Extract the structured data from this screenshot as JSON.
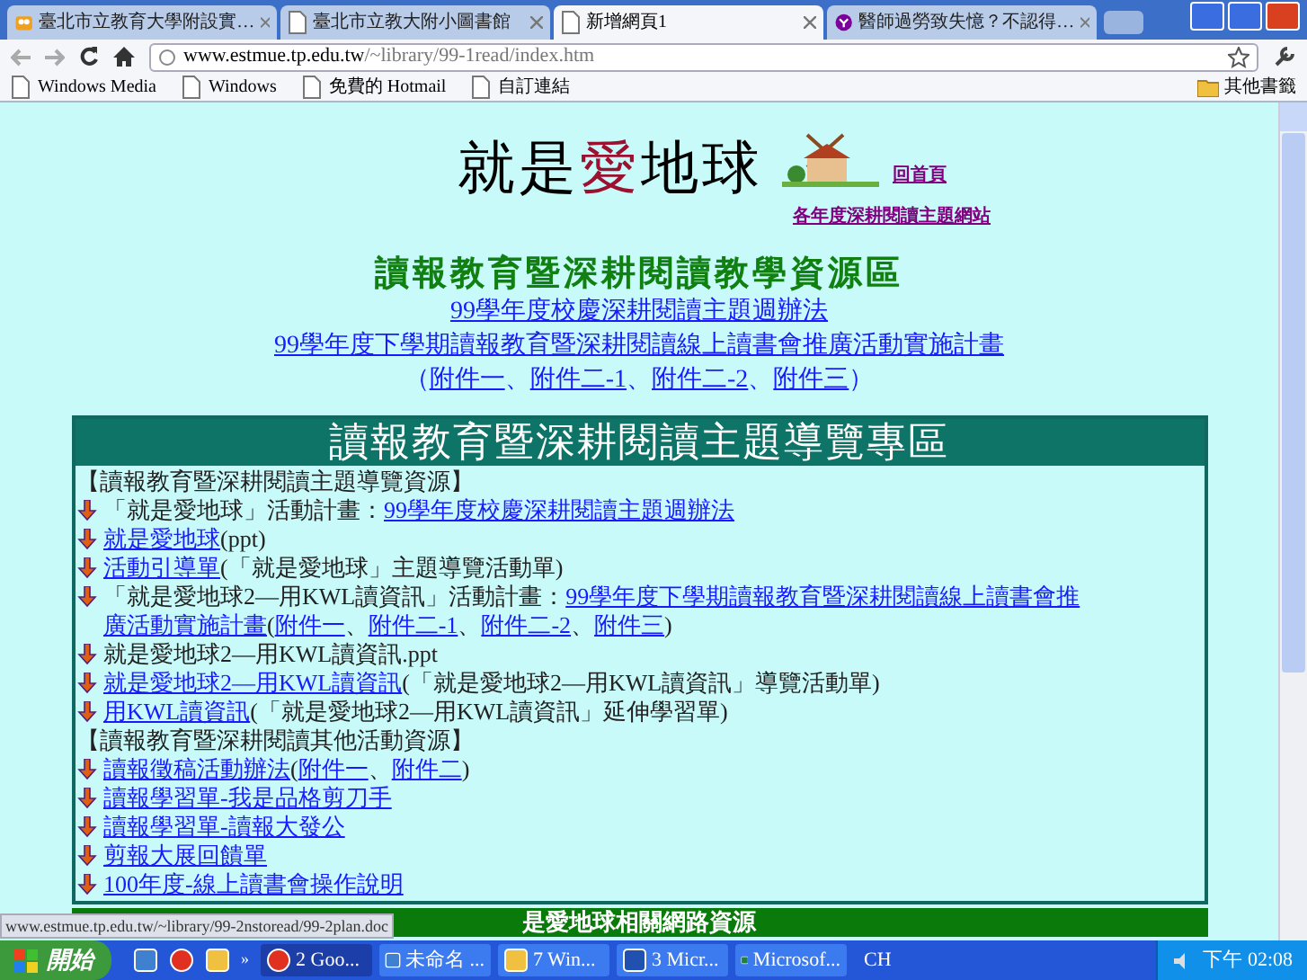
{
  "browser": {
    "tabs": [
      {
        "title": "臺北市立教育大學附設實…",
        "selected": false
      },
      {
        "title": "臺北市立教大附小圖書館",
        "selected": false
      },
      {
        "title": "新增網頁1",
        "selected": true
      },
      {
        "title": "醫師過勞致失憶？不認得…",
        "selected": false
      }
    ],
    "address": {
      "host": "www.estmue.tp.edu.tw",
      "path": "/~library/99-1read/index.htm"
    },
    "bookmarks": [
      "Windows Media",
      "Windows",
      "免費的 Hotmail",
      "自訂連結"
    ],
    "other_bookmarks": "其他書籤"
  },
  "page": {
    "title_parts": [
      {
        "text": "就是",
        "color": "#000000"
      },
      {
        "text": "愛",
        "color": "#9c1030"
      },
      {
        "text": "地球",
        "color": "#000000"
      }
    ],
    "home_link": "回首頁",
    "sites_link": "各年度深耕閱讀主題網站",
    "section_title": "讀報教育暨深耕閱讀教學資源區",
    "links": [
      "99學年度校慶深耕閱讀主題週辦法",
      "99學年度下學期讀報教育暨深耕閱讀線上讀書會推廣活動實施計畫"
    ],
    "attachments": {
      "open": "（",
      "close": "）",
      "separator": "、",
      "items": [
        "附件一",
        "附件二-1",
        "附件二-2",
        "附件三"
      ]
    },
    "panel": {
      "title": "讀報教育暨深耕閱讀主題導覽專區",
      "entries": [
        {
          "kind": "heading",
          "parts": [
            {
              "text": "【讀報教育暨深耕閱讀主題導覽資源】",
              "link": false
            }
          ]
        },
        {
          "kind": "item",
          "parts": [
            {
              "text": "「就是愛地球」活動計畫：",
              "link": false
            },
            {
              "text": "99學年度校慶深耕閱讀主題週辦法",
              "link": true
            }
          ]
        },
        {
          "kind": "item",
          "parts": [
            {
              "text": "就是愛地球",
              "link": true
            },
            {
              "text": "(ppt)",
              "link": false
            }
          ]
        },
        {
          "kind": "item",
          "parts": [
            {
              "text": "活動引導單",
              "link": true
            },
            {
              "text": "(「就是愛地球」主題導覽活動單)",
              "link": false
            }
          ]
        },
        {
          "kind": "item",
          "parts": [
            {
              "text": "「就是愛地球2—用KWL讀資訊」活動計畫：",
              "link": false
            },
            {
              "text": "99學年度下學期讀報教育暨深耕閱讀線上讀書會推",
              "link": true
            },
            {
              "text": "廣活動實施計畫",
              "link": true
            },
            {
              "text": "(",
              "link": false
            },
            {
              "text": "附件一",
              "link": true
            },
            {
              "text": "、",
              "link": false
            },
            {
              "text": "附件二-1",
              "link": true
            },
            {
              "text": "、",
              "link": false
            },
            {
              "text": "附件二-2",
              "link": true
            },
            {
              "text": "、",
              "link": false
            },
            {
              "text": "附件三",
              "link": true
            },
            {
              "text": ")",
              "link": false
            }
          ]
        },
        {
          "kind": "item",
          "parts": [
            {
              "text": "就是愛地球2—用KWL讀資訊.ppt",
              "link": false
            }
          ]
        },
        {
          "kind": "item",
          "parts": [
            {
              "text": "就是愛地球2—用KWL讀資訊",
              "link": true
            },
            {
              "text": "(「就是愛地球2—用KWL讀資訊」導覽活動單)",
              "link": false
            }
          ]
        },
        {
          "kind": "item",
          "parts": [
            {
              "text": "用KWL讀資訊",
              "link": true
            },
            {
              "text": "(「就是愛地球2—用KWL讀資訊」延伸學習單)",
              "link": false
            }
          ]
        },
        {
          "kind": "heading",
          "parts": [
            {
              "text": "【讀報教育暨深耕閱讀其他活動資源】",
              "link": false
            }
          ]
        },
        {
          "kind": "item",
          "parts": [
            {
              "text": "讀報徵稿活動辦法",
              "link": true
            },
            {
              "text": "(",
              "link": false
            },
            {
              "text": "附件一",
              "link": true
            },
            {
              "text": "、",
              "link": false
            },
            {
              "text": "附件二",
              "link": true
            },
            {
              "text": ")",
              "link": false
            }
          ]
        },
        {
          "kind": "item",
          "parts": [
            {
              "text": "讀報學習單-我是品格剪刀手",
              "link": true
            }
          ]
        },
        {
          "kind": "item",
          "parts": [
            {
              "text": "讀報學習單-讀報大發公",
              "link": true
            }
          ]
        },
        {
          "kind": "item",
          "parts": [
            {
              "text": "剪報大展回饋單",
              "link": true
            }
          ]
        },
        {
          "kind": "item",
          "parts": [
            {
              "text": "100年度-線上讀書會操作說明",
              "link": true
            }
          ]
        }
      ]
    },
    "next_panel_title": "是愛地球相關網路資源"
  },
  "status_url": "www.estmue.tp.edu.tw/~library/99-2nstoread/99-2plan.doc",
  "taskbar": {
    "start": "開始",
    "more": "»",
    "tasks": [
      {
        "title": "2 Goo...",
        "selected": true
      },
      {
        "title": "未命名 ...",
        "selected": false
      },
      {
        "title": "7 Win...",
        "selected": false
      },
      {
        "title": "3 Micr...",
        "selected": false
      },
      {
        "title": "Microsof...",
        "selected": false
      }
    ],
    "language": "CH",
    "clock": "下午 02:08"
  }
}
